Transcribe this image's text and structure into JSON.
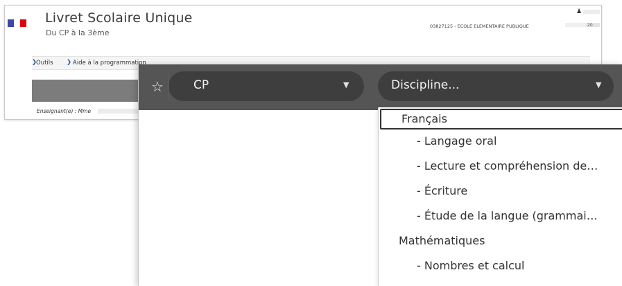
{
  "header": {
    "app_title": "Livret Scolaire Unique",
    "app_subtitle": "Du CP à la 3ème",
    "user_icon": "person-icon",
    "school_info": "03827125 - ECOLE ELEMENTAIRE PUBLIQUE",
    "year_partial": "20"
  },
  "breadcrumb": {
    "items": [
      "Outils",
      "Aide à la programmation"
    ]
  },
  "teacher": {
    "label": "Enseignant(e) : Mme"
  },
  "toolbar": {
    "star_icon": "star-icon",
    "level": {
      "value": "CP"
    },
    "discipline": {
      "placeholder": "Discipline..."
    }
  },
  "dropdown": {
    "options": [
      {
        "label": "Français",
        "type": "group",
        "selected": true
      },
      {
        "label": "- Langage oral",
        "type": "sub"
      },
      {
        "label": "- Lecture et compréhension de…",
        "type": "sub"
      },
      {
        "label": "- Écriture",
        "type": "sub"
      },
      {
        "label": "- Étude de la langue (grammai…",
        "type": "sub"
      },
      {
        "label": "Mathématiques",
        "type": "group"
      },
      {
        "label": "- Nombres et calcul",
        "type": "sub"
      }
    ]
  },
  "colors": {
    "toolbar_bg": "#555555",
    "select_bg": "#3e3e3e",
    "flag_blue": "#3949a5",
    "flag_red": "#e1000f",
    "breadcrumb_chevron": "#1a5aa6"
  }
}
